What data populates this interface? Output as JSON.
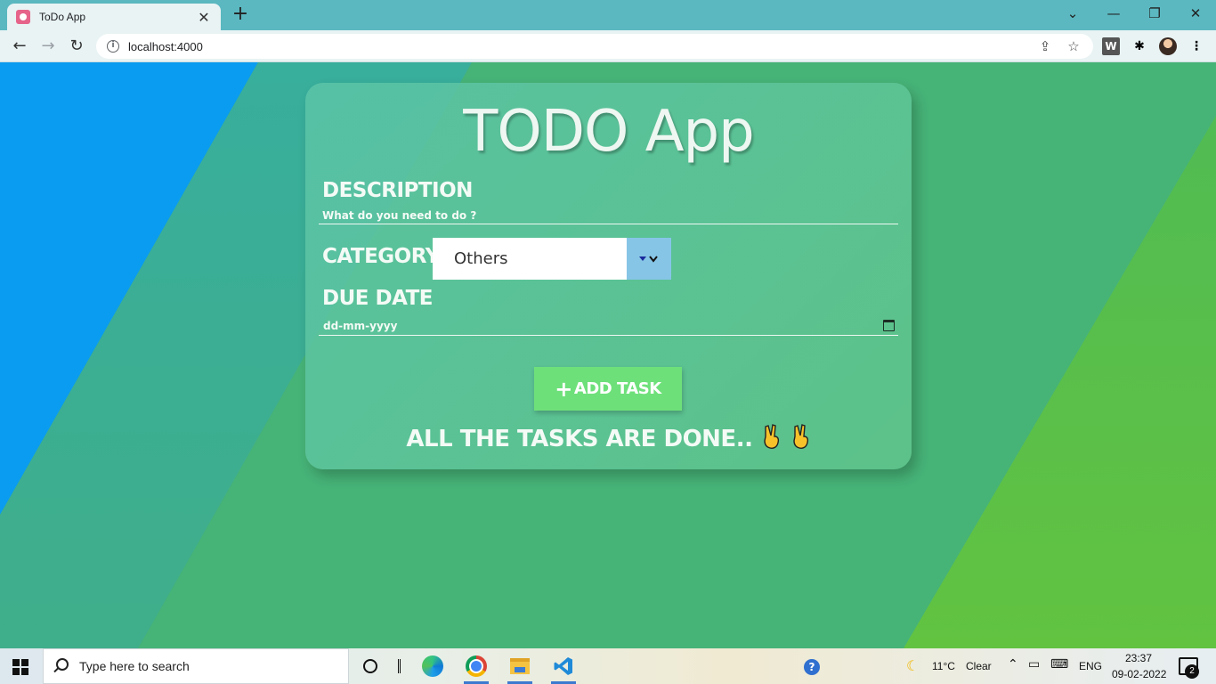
{
  "browser": {
    "tab_title": "ToDo App",
    "url": "localhost:4000",
    "close_glyph": "✕",
    "new_tab_glyph": "+",
    "window_controls": {
      "tabsearch": "⌄",
      "minimize": "—",
      "restore": "❐",
      "close": "✕"
    }
  },
  "app": {
    "title": "TODO App",
    "description_label": "DESCRIPTION",
    "description_placeholder": "What do you need to do ?",
    "category_label": "CATEGORY",
    "category_value": "Others",
    "due_date_label": "DUE DATE",
    "due_date_placeholder": "dd-mm-yyyy",
    "add_button_plus": "+",
    "add_button_label": "ADD TASK",
    "done_message": "ALL THE TASKS ARE DONE.."
  },
  "taskbar": {
    "search_placeholder": "Type here to search",
    "weather_temp": "11°C",
    "weather_desc": "Clear",
    "language": "ENG",
    "time": "23:37",
    "date": "09-02-2022",
    "notification_count": "2"
  },
  "colors": {
    "card_accent": "#5ec49a",
    "button": "#6ee07a",
    "select_arrow_bg": "#86c5e6"
  }
}
